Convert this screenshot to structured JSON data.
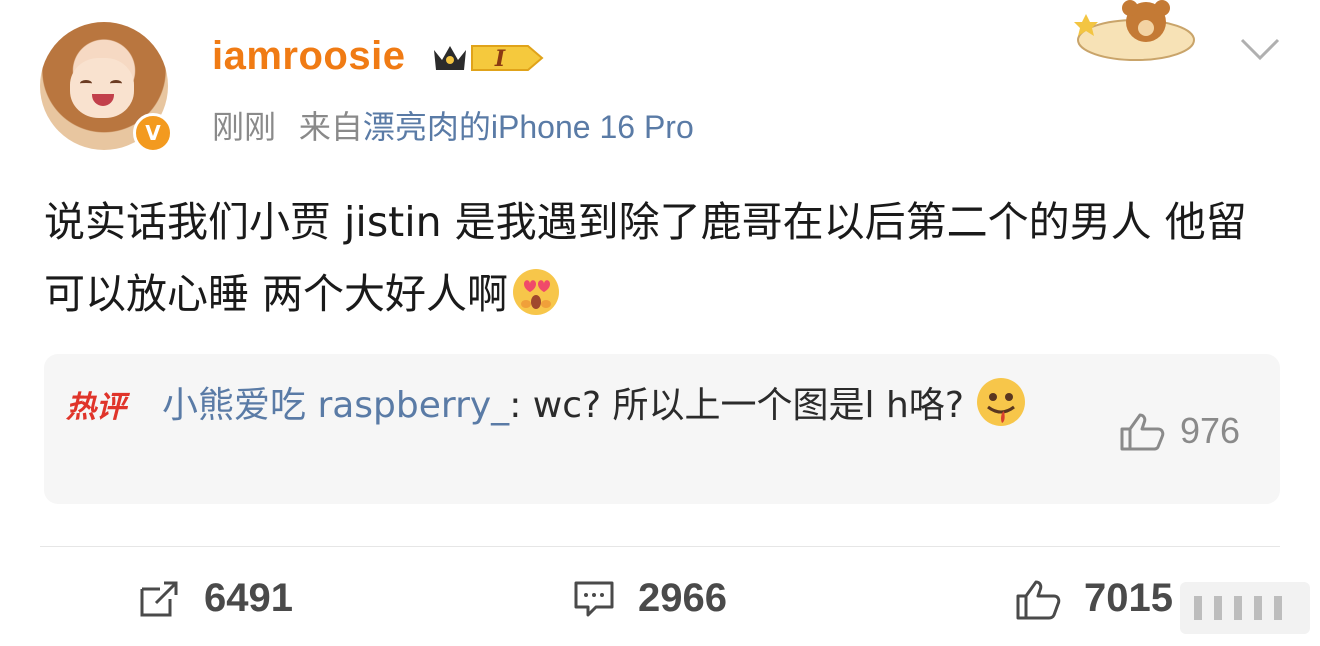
{
  "post": {
    "username": "iamroosie",
    "badge_level": "I",
    "time": "刚刚",
    "source_prefix": "来自",
    "source_device": "漂亮肉的iPhone 16 Pro",
    "text": "说实话我们小贾 jistin 是我遇到除了鹿哥在以后第二个的男人 他留可以放心睡 两个大好人啊",
    "text_emoji": "heart-eyes-emoji"
  },
  "hot_comment": {
    "label": "热评",
    "author": "小熊爱吃 raspberry_",
    "separator": ": ",
    "text": "wc?  所以上一个图是l h咯?",
    "emoji": "drooling-emoji",
    "likes": "976"
  },
  "actions": {
    "reposts": "6491",
    "comments": "2966",
    "likes": "7015"
  },
  "colors": {
    "username": "#f07b14",
    "link": "#5a7ba6",
    "hot_label": "#e0342a",
    "muted": "#8a8a8a"
  }
}
